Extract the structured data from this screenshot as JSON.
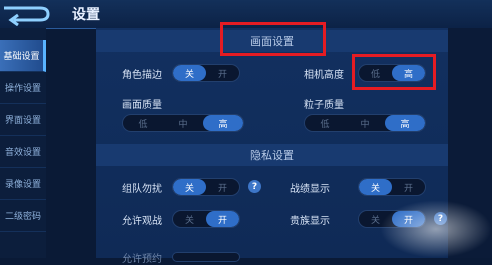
{
  "header": {
    "title": "设置"
  },
  "sidebar": {
    "items": [
      {
        "label": "基础设置",
        "active": true
      },
      {
        "label": "操作设置",
        "active": false
      },
      {
        "label": "界面设置",
        "active": false
      },
      {
        "label": "音效设置",
        "active": false
      },
      {
        "label": "录像设置",
        "active": false
      },
      {
        "label": "二级密码",
        "active": false
      }
    ]
  },
  "display_section": {
    "title": "画面设置",
    "outline": {
      "label": "角色描边",
      "on": "关",
      "off": "开",
      "selected": "关"
    },
    "camera_height": {
      "label": "相机高度",
      "low": "低",
      "high": "高",
      "selected": "高"
    },
    "quality": {
      "label": "画面质量",
      "options": [
        "低",
        "中",
        "高"
      ],
      "selected": "高"
    },
    "particle": {
      "label": "粒子质量",
      "options": [
        "低",
        "中",
        "高"
      ],
      "selected": "高"
    }
  },
  "privacy_section": {
    "title": "隐私设置",
    "team_dnd": {
      "label": "组队勿扰",
      "off": "关",
      "on": "开",
      "selected": "关",
      "help": "?"
    },
    "record_display": {
      "label": "战绩显示",
      "off": "关",
      "on": "开",
      "selected": "关"
    },
    "allow_watch": {
      "label": "允许观战",
      "off": "关",
      "on": "开",
      "selected": "开"
    },
    "noble_display": {
      "label": "贵族显示",
      "off": "关",
      "on": "开",
      "selected": "开",
      "help": "?"
    },
    "cut_label": "允许预约"
  },
  "colors": {
    "accent": "#2f6ec8",
    "highlight": "#e51c23",
    "background": "#0a1a36"
  }
}
